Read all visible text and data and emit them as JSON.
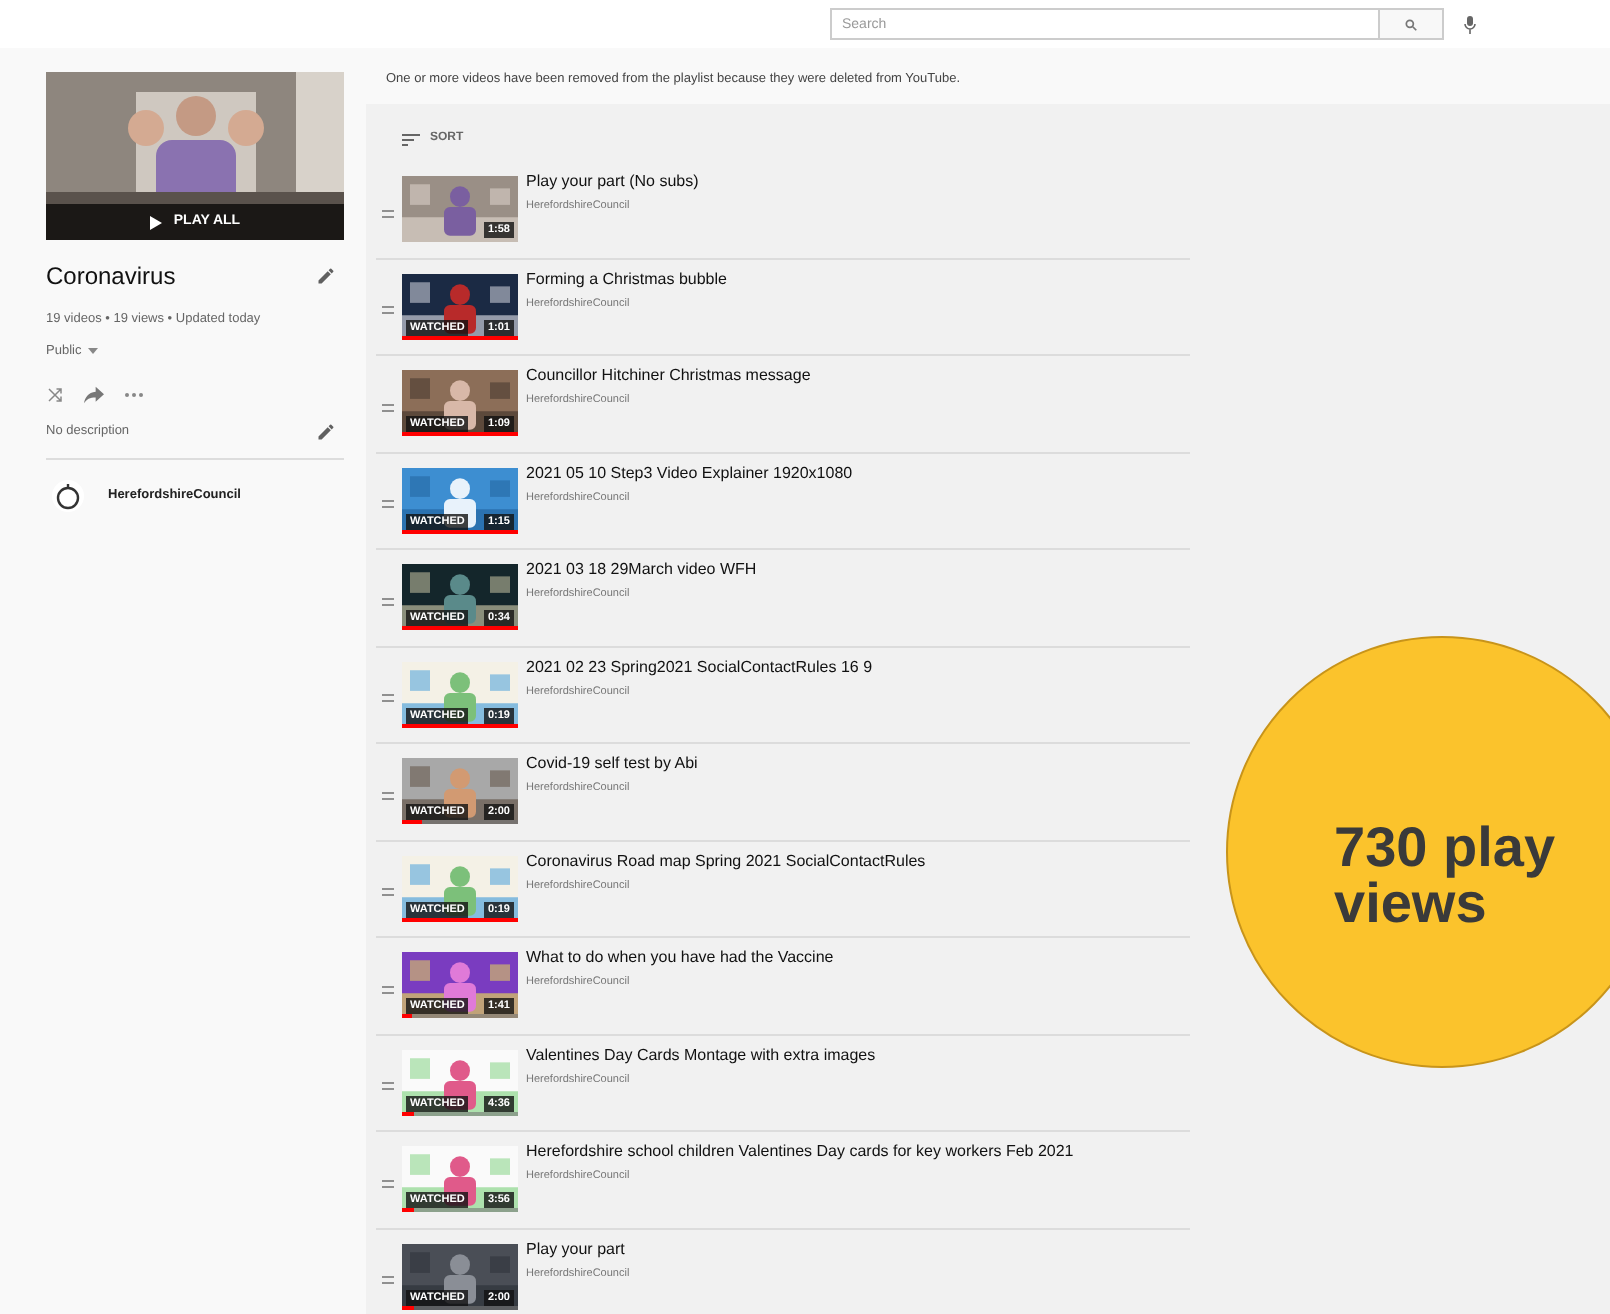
{
  "search": {
    "placeholder": "Search"
  },
  "playlist": {
    "play_all": "PLAY ALL",
    "title": "Coronavirus",
    "stats": "19 videos • 19 views • Updated today",
    "privacy": "Public",
    "description": "No description",
    "owner": "HerefordshireCouncil"
  },
  "notice": "One or more videos have been removed from the playlist because they were deleted from YouTube.",
  "sort": "SORT",
  "videos": [
    {
      "title": "Play your part (No subs)",
      "channel": "HerefordshireCouncil",
      "duration": "1:58",
      "watched": false
    },
    {
      "title": "Forming a Christmas bubble",
      "channel": "HerefordshireCouncil",
      "duration": "1:01",
      "watched": true,
      "label": "WATCHED",
      "level": 1
    },
    {
      "title": "Councillor Hitchiner Christmas message",
      "channel": "HerefordshireCouncil",
      "duration": "1:09",
      "watched": true,
      "label": "WATCHED",
      "level": 1
    },
    {
      "title": "2021 05 10 Step3 Video Explainer 1920x1080",
      "channel": "HerefordshireCouncil",
      "duration": "1:15",
      "watched": true,
      "label": "WATCHED",
      "level": 1
    },
    {
      "title": "2021 03 18 29March video WFH",
      "channel": "HerefordshireCouncil",
      "duration": "0:34",
      "watched": true,
      "label": "WATCHED",
      "level": 1
    },
    {
      "title": "2021 02 23 Spring2021 SocialContactRules 16 9",
      "channel": "HerefordshireCouncil",
      "duration": "0:19",
      "watched": true,
      "label": "WATCHED",
      "level": 1
    },
    {
      "title": "Covid-19 self test by Abi",
      "channel": "HerefordshireCouncil",
      "duration": "2:00",
      "watched": true,
      "label": "WATCHED",
      "level": 0.18
    },
    {
      "title": "Coronavirus Road map Spring 2021 SocialContactRules",
      "channel": "HerefordshireCouncil",
      "duration": "0:19",
      "watched": true,
      "label": "WATCHED",
      "level": 1
    },
    {
      "title": "What to do when you have had the Vaccine",
      "channel": "HerefordshireCouncil",
      "duration": "1:41",
      "watched": true,
      "label": "WATCHED",
      "level": 0.08
    },
    {
      "title": "Valentines Day Cards Montage with extra images",
      "channel": "HerefordshireCouncil",
      "duration": "4:36",
      "watched": true,
      "label": "WATCHED",
      "level": 0.1
    },
    {
      "title": "Herefordshire school children Valentines Day cards for key workers Feb 2021",
      "channel": "HerefordshireCouncil",
      "duration": "3:56",
      "watched": true,
      "label": "WATCHED",
      "level": 0.1
    },
    {
      "title": "Play your part",
      "channel": "HerefordshireCouncil",
      "duration": "2:00",
      "watched": true,
      "label": "WATCHED",
      "level": 0.1
    }
  ],
  "callout": {
    "lines": [
      "730 play",
      "views"
    ]
  }
}
